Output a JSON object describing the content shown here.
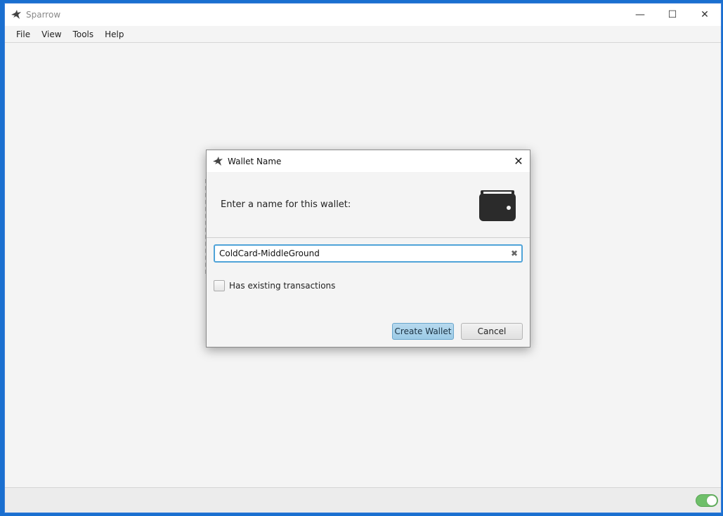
{
  "app": {
    "title": "Sparrow",
    "icon": "sparrow-bird-icon"
  },
  "window_controls": {
    "minimize": "—",
    "maximize": "☐",
    "close": "✕"
  },
  "menu": {
    "items": [
      "File",
      "View",
      "Tools",
      "Help"
    ]
  },
  "dialog": {
    "title": "Wallet Name",
    "close": "✕",
    "header_text": "Enter a name for this wallet:",
    "header_icon": "wallet-icon",
    "name_field": {
      "value": "ColdCard-MiddleGround",
      "clear_icon": "✖"
    },
    "checkbox": {
      "label": "Has existing transactions",
      "checked": false
    },
    "buttons": {
      "create": "Create Wallet",
      "cancel": "Cancel"
    }
  },
  "status": {
    "toggle_on": true,
    "toggle_color": "#6fbf6a"
  },
  "colors": {
    "accent": "#4fa3d8",
    "primary_button": "#9ccbe6",
    "desktop": "#1a6fd0"
  }
}
